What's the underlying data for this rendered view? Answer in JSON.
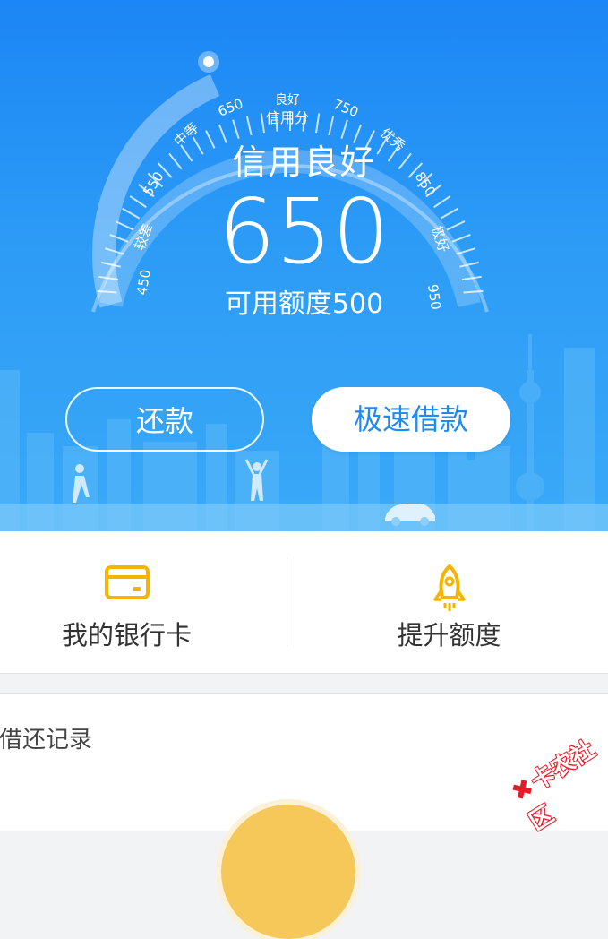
{
  "gauge": {
    "center_label": "信用分",
    "top_label": "良好",
    "ticks": [
      "450",
      "550",
      "650",
      "750",
      "850",
      "950"
    ],
    "levels": [
      "较差",
      "中等",
      "优秀",
      "极好"
    ],
    "status": "信用良好",
    "score": "650",
    "limit_text": "可用额度500"
  },
  "buttons": {
    "repay": "还款",
    "fast_loan": "极速借款"
  },
  "actions": {
    "bank_card": "我的银行卡",
    "raise_limit": "提升额度"
  },
  "records": {
    "label": "借还记录"
  },
  "watermark": {
    "text": "卡农社区"
  },
  "colors": {
    "primary_blue": "#1d8bf2",
    "icon_yellow": "#f5b400"
  },
  "icons": {
    "bank_card": "card-icon",
    "raise_limit": "rocket-icon"
  }
}
